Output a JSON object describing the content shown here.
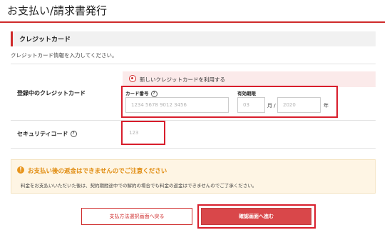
{
  "page": {
    "title": "お支払い/請求書発行"
  },
  "section": {
    "heading": "クレジットカード",
    "intro": "クレジットカード情報を入力してください。"
  },
  "registered_card": {
    "label": "登録中のクレジットカード",
    "new_card_option": "新しいクレジットカードを利用する"
  },
  "card_form": {
    "number_label": "カード番号",
    "number_placeholder": "1234 5678 9012 3456",
    "expiry_label": "有効期限",
    "month_placeholder": "03",
    "month_unit": "月 /",
    "year_placeholder": "2020",
    "year_unit": "年"
  },
  "security": {
    "label": "セキュリティコード",
    "placeholder": "123"
  },
  "notice": {
    "title": "お支払い後の返金はできませんのでご注意ください",
    "text": "料金をお支払いいただいた後は、契約期間途中での解約の場合でも料金の返金はできませんのでご了承ください。"
  },
  "buttons": {
    "back": "支払方法選択画面へ戻る",
    "confirm": "確認画面へ進む"
  },
  "help_glyph": "?",
  "warning_glyph": "!",
  "colors": {
    "accent": "#cf2b2b",
    "highlight": "#d81e2c",
    "notice_bg": "#fef5e4",
    "notice_title": "#e08a0c",
    "confirm_bg": "#d9474a"
  }
}
